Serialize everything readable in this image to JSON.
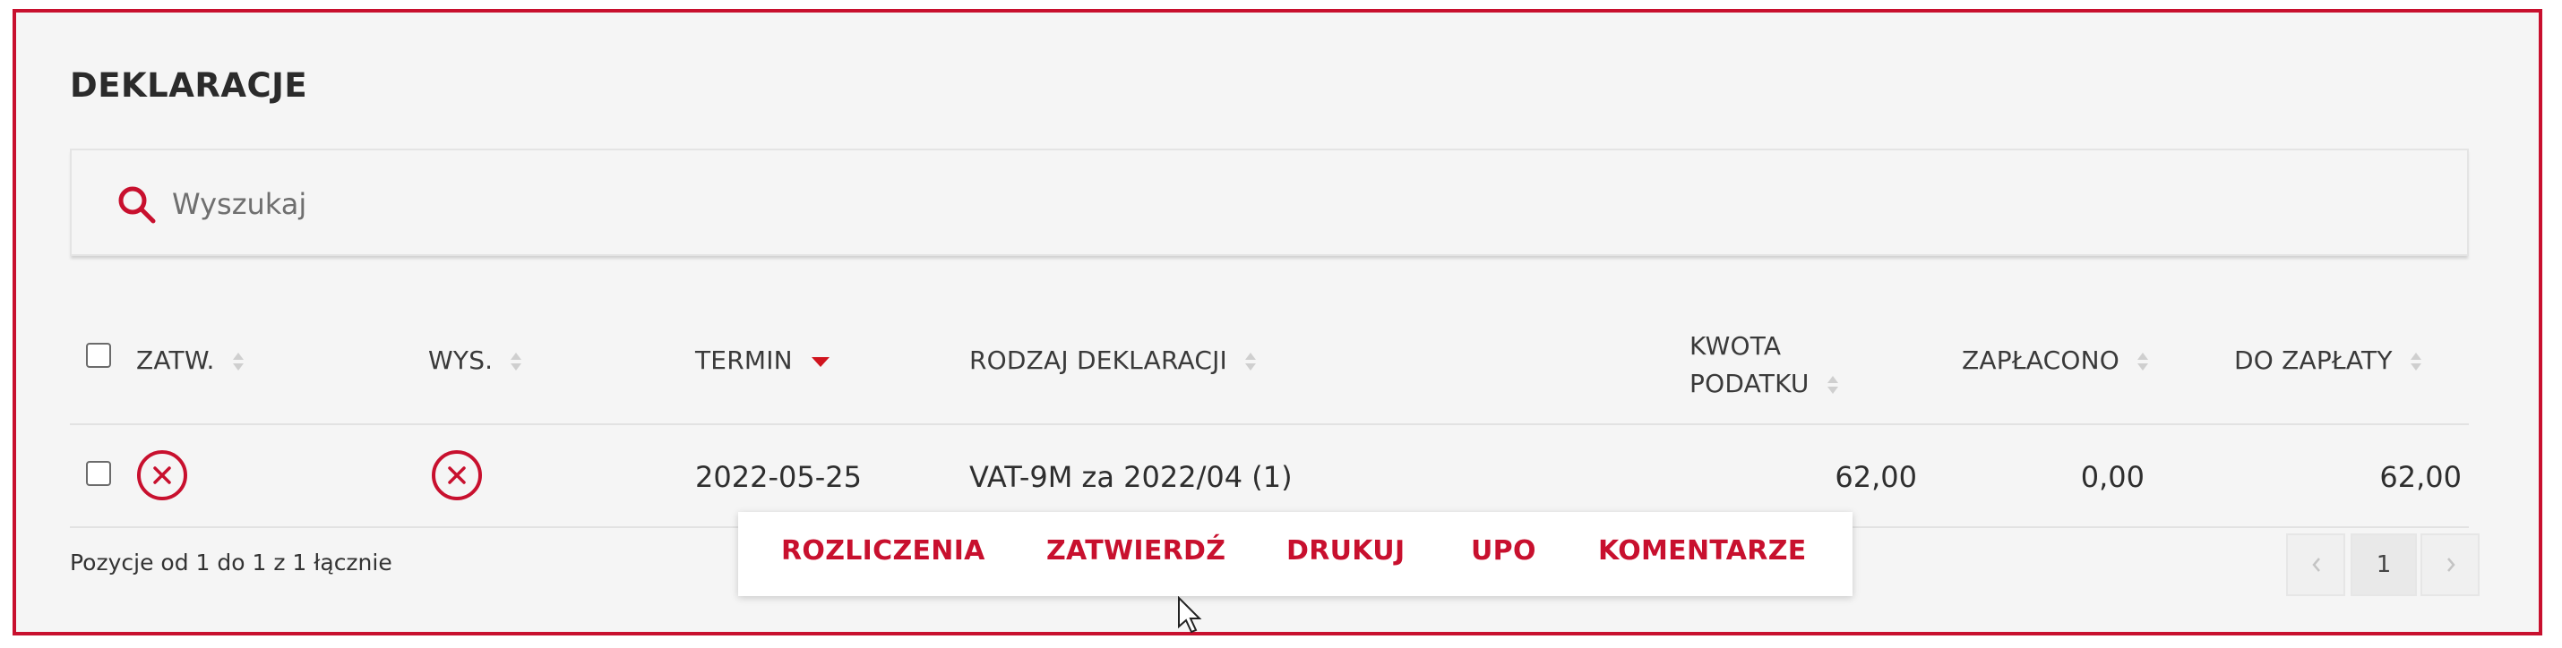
{
  "section": {
    "title": "DEKLARACJE"
  },
  "search": {
    "placeholder": "Wyszukaj"
  },
  "table": {
    "columns": {
      "zatw": "ZATW.",
      "wys": "WYS.",
      "termin": "TERMIN",
      "rodzaj": "RODZAJ DEKLARACJI",
      "kwota_line1": "KWOTA",
      "kwota_line2": "PODATKU",
      "zaplacono": "ZAPŁACONO",
      "do_zaplaty": "DO ZAPŁATY"
    },
    "rows": [
      {
        "zatw_status": "x-circle-icon",
        "wys_status": "x-circle-icon",
        "termin": "2022-05-25",
        "rodzaj": "VAT-9M za 2022/04 (1)",
        "kwota": "62,00",
        "zaplacono": "0,00",
        "do_zaplaty": "62,00"
      }
    ]
  },
  "footer": {
    "summary": "Pozycje od 1 do 1 z 1 łącznie"
  },
  "actions": {
    "rozliczenia": "ROZLICZENIA",
    "zatwierdz": "ZATWIERDŹ",
    "drukuj": "DRUKUJ",
    "upo": "UPO",
    "komentarze": "KOMENTARZE"
  },
  "pagination": {
    "current_page": "1"
  },
  "colors": {
    "accent": "#c8102e",
    "background": "#f5f5f5"
  }
}
